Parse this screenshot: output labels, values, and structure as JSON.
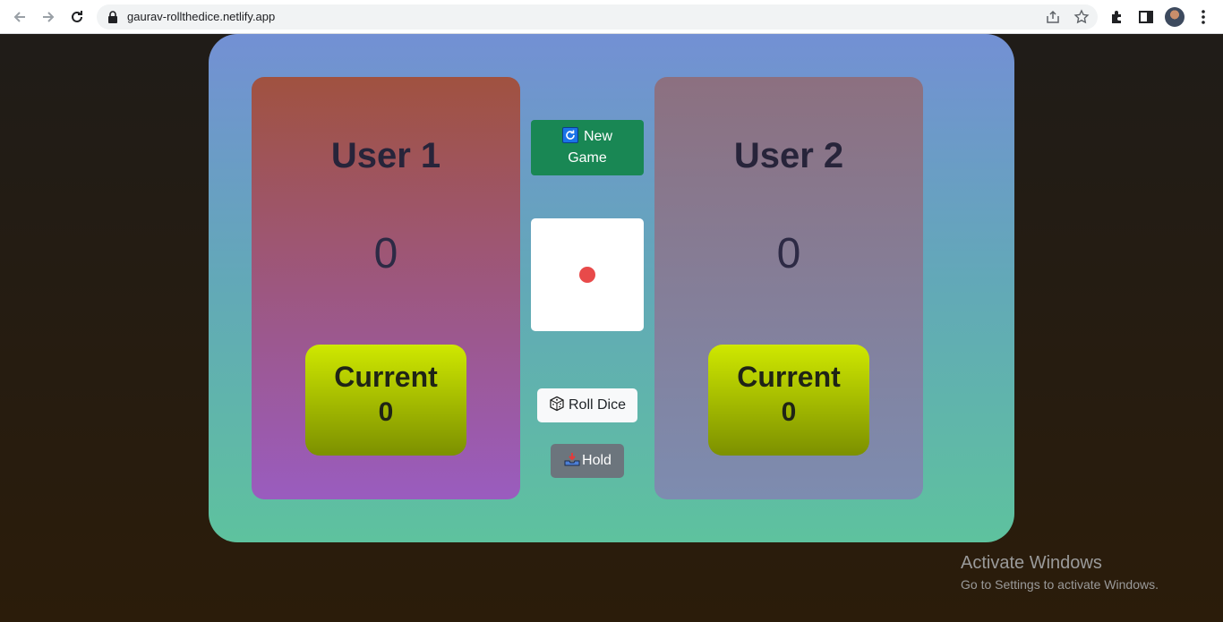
{
  "browser": {
    "url": "gaurav-rollthedice.netlify.app"
  },
  "players": [
    {
      "name": "User 1",
      "score": "0",
      "current_label": "Current",
      "current_value": "0"
    },
    {
      "name": "User 2",
      "score": "0",
      "current_label": "Current",
      "current_value": "0"
    }
  ],
  "controls": {
    "new_game_line1": "New",
    "new_game_line2": "Game",
    "roll_label": "Roll Dice",
    "hold_label": "Hold"
  },
  "dice": {
    "value": 1,
    "pip_color": "#e84a4a"
  },
  "colors": {
    "new_game_bg": "#198754",
    "hold_bg": "#6c757d",
    "roll_bg": "#f8f9fa",
    "current_box_top": "#cfe800",
    "current_box_bottom": "#7c9000"
  },
  "watermark": {
    "title": "Activate Windows",
    "subtitle": "Go to Settings to activate Windows."
  }
}
